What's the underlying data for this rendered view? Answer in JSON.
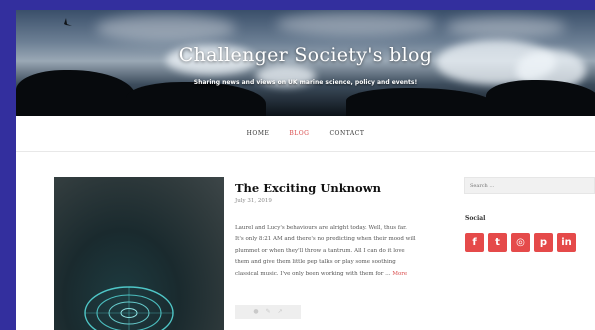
{
  "site": {
    "title": "Challenger Society's blog",
    "tagline": "Sharing news and views on UK marine science, policy and events!"
  },
  "nav": {
    "items": [
      {
        "label": "HOME",
        "active": false
      },
      {
        "label": "BLOG",
        "active": true
      },
      {
        "label": "CONTACT",
        "active": false
      }
    ]
  },
  "post": {
    "title": "The Exciting Unknown",
    "date": "July 31, 2019",
    "excerpt": "Laurel and Lucy's behaviours are alright today. Well, thus far. It's only 8:21 AM and there's no predicting when their mood will plummet or when they'll throw a tantrum. All I can do it love them and give them little pep talks or play some soothing classical music. I've only been working with them for …",
    "more_label": "More",
    "actions": [
      "comment-icon",
      "edit-icon",
      "share-icon"
    ]
  },
  "sidebar": {
    "search_placeholder": "Search …",
    "social_heading": "Social",
    "social_icons": [
      {
        "name": "facebook-icon",
        "glyph": "f"
      },
      {
        "name": "twitter-icon",
        "glyph": "t"
      },
      {
        "name": "instagram-icon",
        "glyph": "◎"
      },
      {
        "name": "pinterest-icon",
        "glyph": "p"
      },
      {
        "name": "linkedin-icon",
        "glyph": "in"
      }
    ]
  },
  "colors": {
    "page_background": "#332f9e",
    "accent": "#d94b4b",
    "social_button": "#e54a4a"
  }
}
